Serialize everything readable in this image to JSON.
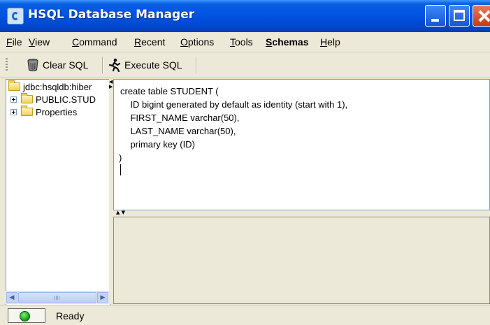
{
  "window": {
    "title": "HSQL Database Manager"
  },
  "menu": [
    "File",
    "View",
    "Command",
    "Recent",
    "Options",
    "Tools",
    "Schemas",
    "Help"
  ],
  "menu_bold": "Schemas",
  "toolbar": {
    "clear_label": "Clear SQL",
    "execute_label": "Execute SQL"
  },
  "tree": {
    "root": "jdbc:hsqldb:hiber",
    "items": [
      "PUBLIC.STUD",
      "Properties"
    ]
  },
  "editor": {
    "lines": [
      "create table STUDENT (",
      "    ID bigint generated by default as identity (start with 1),",
      "    FIRST_NAME varchar(50),",
      "    LAST_NAME varchar(50),",
      "    primary key (ID)",
      ")"
    ]
  },
  "status": {
    "text": "Ready",
    "color": "#0a9c0a"
  }
}
